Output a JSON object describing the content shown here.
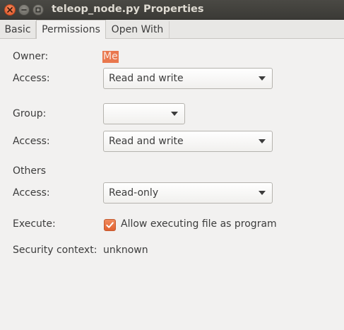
{
  "window": {
    "title": "teleop_node.py Properties"
  },
  "tabs": [
    {
      "label": "Basic"
    },
    {
      "label": "Permissions"
    },
    {
      "label": "Open With"
    }
  ],
  "permissions": {
    "owner_label": "Owner:",
    "owner_value": "Me",
    "owner_access_label": "Access:",
    "owner_access_value": "Read and write",
    "group_label": "Group:",
    "group_value": "",
    "group_access_label": "Access:",
    "group_access_value": "Read and write",
    "others_label": "Others",
    "others_access_label": "Access:",
    "others_access_value": "Read-only",
    "execute_label": "Execute:",
    "execute_checkbox_label": "Allow executing file as program",
    "execute_checked": true,
    "security_label": "Security context:",
    "security_value": "unknown"
  },
  "colors": {
    "accent": "#e9774d",
    "titlebar": "#3f3e3a",
    "background": "#f2f1f0"
  },
  "icons": {
    "close": "close-icon",
    "minimize": "minimize-icon",
    "maximize": "maximize-icon",
    "dropdown": "chevron-down-icon",
    "check": "check-icon"
  }
}
